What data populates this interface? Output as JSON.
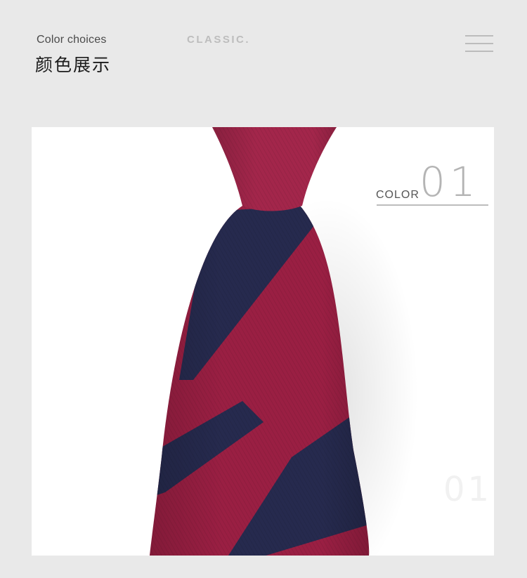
{
  "header": {
    "subtitle_en": "Color choices",
    "title_cn": "颜色展示",
    "brand_tag": "CLASSIC."
  },
  "menu": {
    "icon": "hamburger-menu-icon"
  },
  "product": {
    "color_label": "COLOR",
    "color_number": "01",
    "watermark_number": "01",
    "image": "striped-necktie",
    "colors": {
      "burgundy": "#9a1f43",
      "navy": "#262a4e",
      "background": "#e9e9e9",
      "card": "#ffffff"
    }
  }
}
